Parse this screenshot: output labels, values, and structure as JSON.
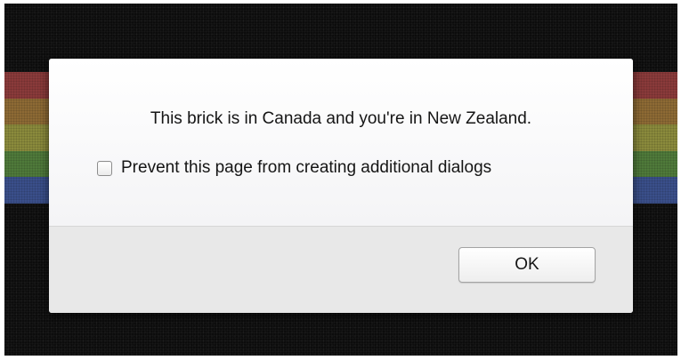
{
  "dialog": {
    "message": "This brick is in Canada and you're in New Zealand.",
    "checkbox": {
      "label": "Prevent this page from creating additional dialogs",
      "checked": false
    },
    "ok_button": "OK"
  },
  "background": {
    "stripe_colors": [
      "#8a3a3a",
      "#8d6a34",
      "#8a8a3c",
      "#4f7a3a",
      "#3a4f8a"
    ]
  }
}
